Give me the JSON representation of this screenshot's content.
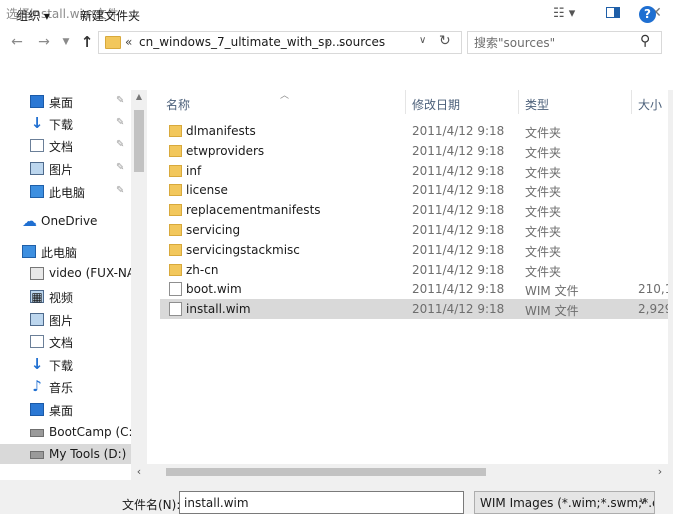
{
  "window": {
    "title": "选择install.wim文件."
  },
  "address": {
    "chevrons": "«",
    "segments": [
      "cn_windows_7_ultimate_with_sp...",
      "sources"
    ],
    "separator": "›"
  },
  "search": {
    "placeholder": "搜索\"sources\""
  },
  "toolbar": {
    "organize_label": "组织 ▾",
    "new_folder_label": "新建文件夹"
  },
  "nav": {
    "items": [
      {
        "label": "桌面",
        "icon": "desktop-icon",
        "pinned": true
      },
      {
        "label": "下载",
        "icon": "download-icon",
        "pinned": true
      },
      {
        "label": "文档",
        "icon": "document-icon",
        "pinned": true
      },
      {
        "label": "图片",
        "icon": "pictures-icon",
        "pinned": true
      },
      {
        "label": "此电脑",
        "icon": "computer-icon",
        "pinned": true
      },
      {
        "label": "OneDrive",
        "icon": "onedrive-icon",
        "pinned": false
      },
      {
        "label": "此电脑",
        "icon": "computer-icon",
        "pinned": false
      },
      {
        "label": "video (FUX-NA",
        "icon": "network-drive-icon",
        "pinned": false
      },
      {
        "label": "视频",
        "icon": "videos-icon",
        "pinned": false
      },
      {
        "label": "图片",
        "icon": "pictures-icon",
        "pinned": false
      },
      {
        "label": "文档",
        "icon": "document-icon",
        "pinned": false
      },
      {
        "label": "下载",
        "icon": "download-icon",
        "pinned": false
      },
      {
        "label": "音乐",
        "icon": "music-icon",
        "pinned": false
      },
      {
        "label": "桌面",
        "icon": "desktop-icon",
        "pinned": false
      },
      {
        "label": "BootCamp (C:)",
        "icon": "drive-icon",
        "pinned": false
      },
      {
        "label": "My Tools (D:)",
        "icon": "drive-icon",
        "pinned": false,
        "selected": true
      }
    ]
  },
  "columns": {
    "name": "名称",
    "modified": "修改日期",
    "type": "类型",
    "size": "大小"
  },
  "files": [
    {
      "name": "dlmanifests",
      "modified": "2011/4/12 9:18",
      "type": "文件夹",
      "size": "",
      "kind": "folder"
    },
    {
      "name": "etwproviders",
      "modified": "2011/4/12 9:18",
      "type": "文件夹",
      "size": "",
      "kind": "folder"
    },
    {
      "name": "inf",
      "modified": "2011/4/12 9:18",
      "type": "文件夹",
      "size": "",
      "kind": "folder"
    },
    {
      "name": "license",
      "modified": "2011/4/12 9:18",
      "type": "文件夹",
      "size": "",
      "kind": "folder"
    },
    {
      "name": "replacementmanifests",
      "modified": "2011/4/12 9:18",
      "type": "文件夹",
      "size": "",
      "kind": "folder"
    },
    {
      "name": "servicing",
      "modified": "2011/4/12 9:18",
      "type": "文件夹",
      "size": "",
      "kind": "folder"
    },
    {
      "name": "servicingstackmisc",
      "modified": "2011/4/12 9:18",
      "type": "文件夹",
      "size": "",
      "kind": "folder"
    },
    {
      "name": "zh-cn",
      "modified": "2011/4/12 9:18",
      "type": "文件夹",
      "size": "",
      "kind": "folder"
    },
    {
      "name": "boot.wim",
      "modified": "2011/4/12 9:18",
      "type": "WIM 文件",
      "size": "210,1",
      "kind": "file"
    },
    {
      "name": "install.wim",
      "modified": "2011/4/12 9:18",
      "type": "WIM 文件",
      "size": "2,929",
      "kind": "file",
      "selected": true
    }
  ],
  "footer": {
    "filename_label": "文件名(N):",
    "filename_value": "install.wim",
    "filetype_value": "WIM Images (*.wim;*.swm;*.e"
  },
  "colors": {
    "accent": "#1f6fd1",
    "selection": "#d9d9d9",
    "folder": "#f2c75c"
  }
}
